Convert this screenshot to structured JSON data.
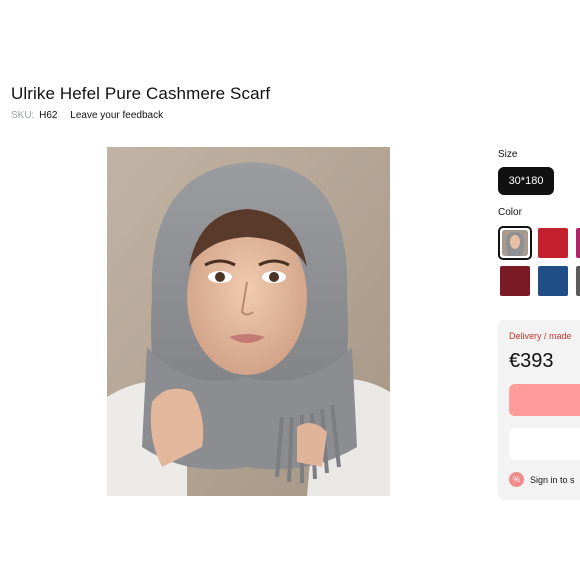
{
  "product": {
    "title": "Ulrike Hefel Pure Cashmere Scarf",
    "sku_label": "SKU:",
    "sku_value": "H62",
    "feedback_link": "Leave your feedback",
    "image_alt": "Woman wearing grey cashmere scarf as hood"
  },
  "options": {
    "size_label": "Size",
    "size_selected": "30*180",
    "color_label": "Color",
    "colors": [
      {
        "name": "grey",
        "hex": "#8e9094",
        "selected": true
      },
      {
        "name": "red",
        "hex": "#c3202f"
      },
      {
        "name": "magenta",
        "hex": "#b7206a"
      },
      {
        "name": "burgundy",
        "hex": "#7a1a24"
      },
      {
        "name": "blue",
        "hex": "#1f4f86"
      },
      {
        "name": "charcoal",
        "hex": "#5b5b5b"
      }
    ]
  },
  "purchase": {
    "delivery_text": "Delivery / made",
    "price": "€393",
    "signin_text": "Sign in to s",
    "signin_icon": "%"
  },
  "colors": {
    "accent": "#ff9b9b",
    "delivery_red": "#d0342c",
    "dark": "#111111"
  }
}
